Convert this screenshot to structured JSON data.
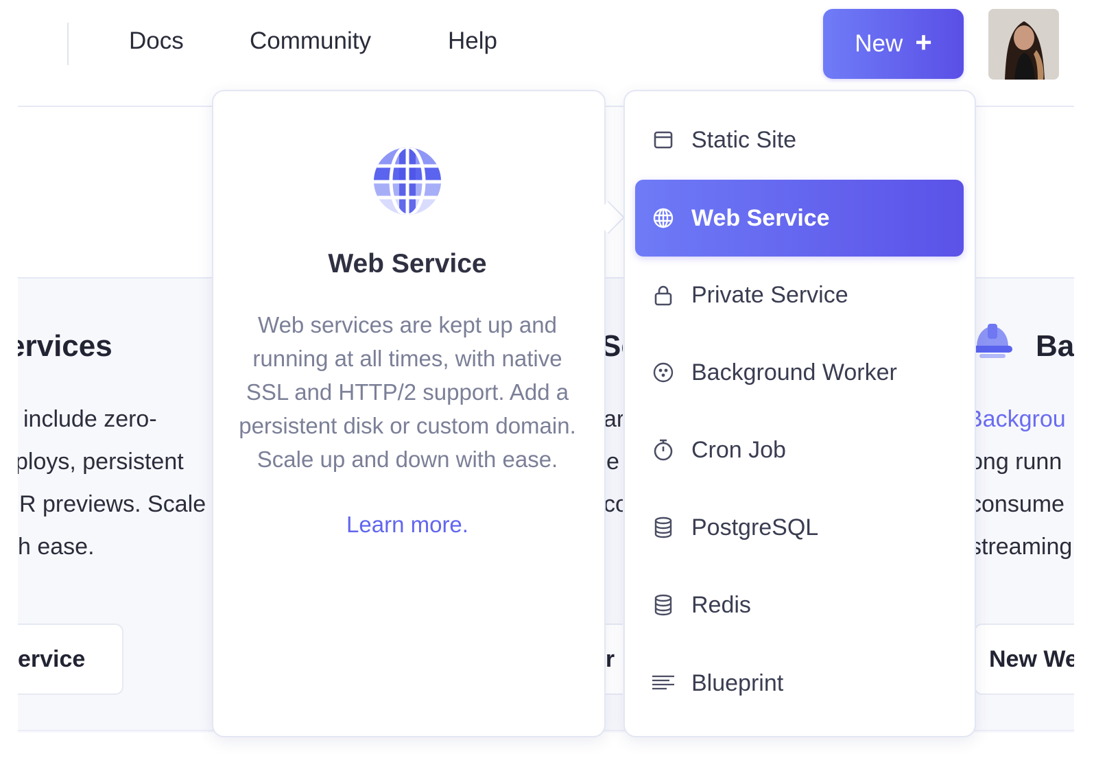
{
  "nav": {
    "links": [
      "Docs",
      "Community",
      "Help"
    ],
    "new_button": "New",
    "new_icon": "plus-icon"
  },
  "background": {
    "left_card": {
      "title_fragment": "ervices",
      "lines": [
        "include zero-",
        "ploys, persistent",
        "R previews. Scale",
        "h ease."
      ],
      "button_fragment": "ervice"
    },
    "middle_fragments": {
      "title": "Se",
      "lines": [
        "ar",
        "e",
        "co"
      ],
      "button": "er"
    },
    "right_card": {
      "title_fragment": "Ba",
      "link_fragment": "Backgrou",
      "lines": [
        "ong runn",
        "consume",
        "streaming"
      ],
      "button_fragment": "New We"
    }
  },
  "info": {
    "icon": "globe-icon",
    "title": "Web Service",
    "description": "Web services are kept up and running at all times, with native SSL and HTTP/2 support. Add a persistent disk or custom domain. Scale up and down with ease.",
    "learn_more": "Learn more."
  },
  "menu": {
    "items": [
      {
        "label": "Static Site",
        "icon": "browser-window-icon",
        "active": false
      },
      {
        "label": "Web Service",
        "icon": "globe-icon",
        "active": true
      },
      {
        "label": "Private Service",
        "icon": "lock-icon",
        "active": false
      },
      {
        "label": "Background Worker",
        "icon": "worker-icon",
        "active": false
      },
      {
        "label": "Cron Job",
        "icon": "stopwatch-icon",
        "active": false
      },
      {
        "label": "PostgreSQL",
        "icon": "database-icon",
        "active": false
      },
      {
        "label": "Redis",
        "icon": "database-icon",
        "active": false
      },
      {
        "label": "Blueprint",
        "icon": "blueprint-lines-icon",
        "active": false
      }
    ]
  },
  "colors": {
    "accent": "#5b52e8",
    "accent_light": "#6e7bf6",
    "link": "#6166ef"
  }
}
